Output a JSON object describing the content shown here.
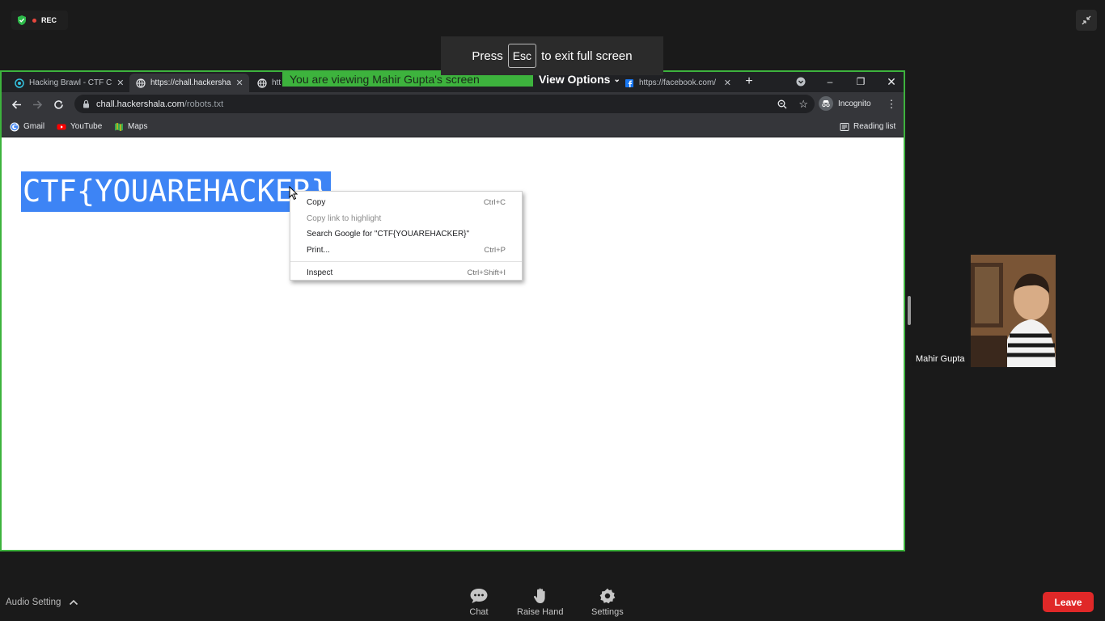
{
  "zoom": {
    "rec_label": "REC",
    "esc_toast": {
      "prefix": "Press",
      "key": "Esc",
      "suffix": "to exit full screen"
    },
    "viewing_banner": "You are viewing Mahir Gupta's screen",
    "view_options": "View Options",
    "participant": "Mahir Gupta",
    "bottom": {
      "audio_setting": "Audio Setting",
      "chat": "Chat",
      "raise_hand": "Raise Hand",
      "settings": "Settings",
      "leave": "Leave"
    },
    "colors": {
      "share_border": "#3db33d",
      "leave": "#e02828"
    }
  },
  "browser": {
    "tabs": [
      {
        "title": "Hacking Brawl - CTF C",
        "icon": "ctf-favicon-icon"
      },
      {
        "title": "https://chall.hackersha",
        "icon": "globe-icon"
      },
      {
        "title": "htt",
        "icon": "globe-icon"
      },
      {
        "title": "https://facebook.com/",
        "icon": "facebook-icon"
      }
    ],
    "url_host": "chall.hackershala.com",
    "url_path": "/robots.txt",
    "profile": "Incognito",
    "bookmarks": [
      "Gmail",
      "YouTube",
      "Maps"
    ],
    "reading_list": "Reading list"
  },
  "page": {
    "content": "CTF{YOUAREHACKER}"
  },
  "context_menu": {
    "items": [
      {
        "label": "Copy",
        "shortcut": "Ctrl+C"
      },
      {
        "label": "Copy link to highlight",
        "shortcut": ""
      },
      {
        "label": "Search Google for \"CTF{YOUAREHACKER}\"",
        "shortcut": ""
      },
      {
        "label": "Print...",
        "shortcut": "Ctrl+P"
      },
      {
        "label": "Inspect",
        "shortcut": "Ctrl+Shift+I"
      }
    ]
  }
}
